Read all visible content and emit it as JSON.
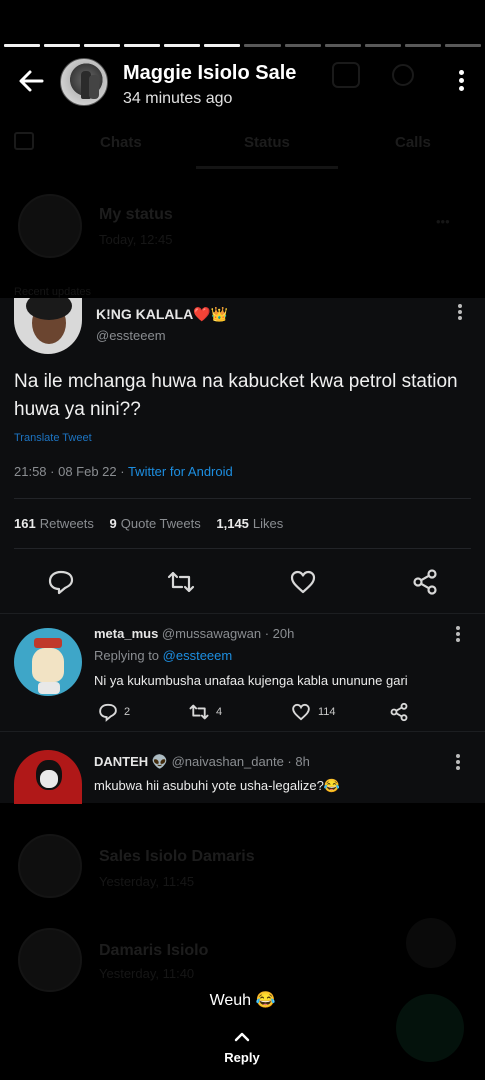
{
  "status": {
    "segments_total": 12,
    "segments_done": 6,
    "contact_name": "Maggie Isiolo Sale",
    "posted_ago": "34 minutes ago",
    "caption": "Weuh 😂",
    "reply_label": "Reply"
  },
  "background": {
    "tabs": [
      "Chats",
      "Status",
      "Calls"
    ],
    "my_status_title": "My status",
    "my_status_sub": "Today, 12:45",
    "recent_label": "Recent updates",
    "rows": [
      {
        "title": "Sales Isiolo Damaris",
        "sub": "Yesterday, 11:45"
      },
      {
        "title": "Damaris Isiolo",
        "sub": "Yesterday, 11:40"
      }
    ]
  },
  "tweet": {
    "name": "K!NG KALALA❤️👑",
    "handle": "@essteeem",
    "text": "Na ile mchanga huwa na kabucket kwa petrol station huwa ya nini??",
    "translate": "Translate Tweet",
    "timestamp": "21:58 · 08 Feb 22 · ",
    "source": "Twitter for Android",
    "retweets_count": "161",
    "retweets_label": "Retweets",
    "quotes_count": "9",
    "quotes_label": "Quote Tweets",
    "likes_count": "1,145",
    "likes_label": "Likes"
  },
  "replies": [
    {
      "name": "meta_mus",
      "handle": " @mussawagwan · 20h",
      "replying_prefix": "Replying to ",
      "replying_to": "@essteeem",
      "text": "Ni ya kukumbusha unafaa kujenga kabla ununune gari",
      "reply_count": "2",
      "retweet_count": "4",
      "like_count": "114"
    },
    {
      "name": "DANTEH 👽",
      "handle": " @naivashan_dante · 8h",
      "text": "mkubwa hii asubuhi yote usha-legalize?😂"
    }
  ]
}
